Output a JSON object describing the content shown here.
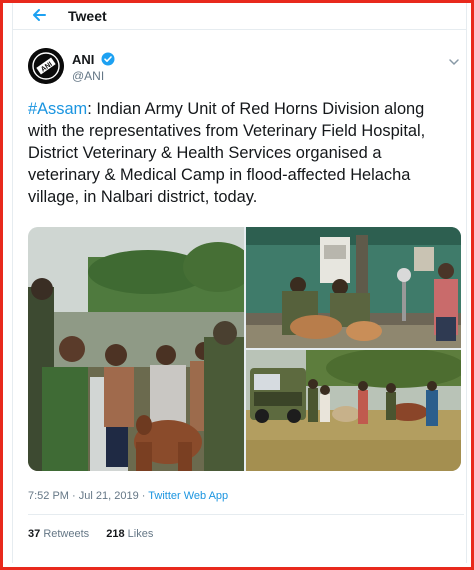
{
  "header": {
    "title": "Tweet",
    "back_icon": "arrow-left-icon",
    "accent_color": "#1da1f2"
  },
  "author": {
    "name": "ANI",
    "handle": "@ANI",
    "avatar_text": "ANI",
    "verified_icon": "verified-badge-icon",
    "menu_icon": "chevron-down-icon"
  },
  "tweet": {
    "hashtag": "#Assam",
    "text": ": Indian Army Unit of Red Horns Division along with the representatives from Veterinary Field Hospital, District Veterinary & Health Services organised a veterinary & Medical Camp in flood-affected Helacha village, in Nalbari district, today."
  },
  "media": {
    "photo_count": 3
  },
  "meta": {
    "time": "7:52 PM",
    "separator": " · ",
    "date": "Jul 21, 2019",
    "source": "Twitter Web App"
  },
  "stats": {
    "retweets_count": "37",
    "retweets_label": "Retweets",
    "likes_count": "218",
    "likes_label": "Likes"
  },
  "colors": {
    "frame_border": "#e8291c",
    "link": "#1b95e0",
    "secondary_text": "#657786"
  }
}
